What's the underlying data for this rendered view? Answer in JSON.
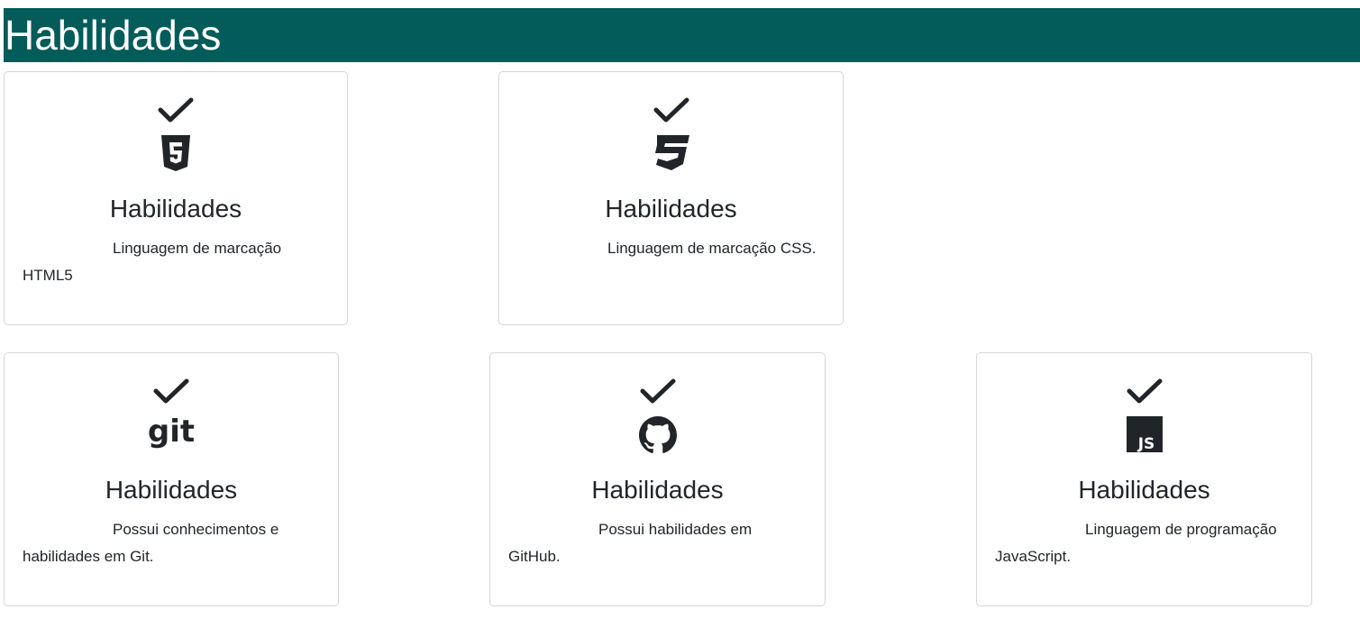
{
  "header": {
    "title": "Habilidades"
  },
  "cards": [
    {
      "icon": "html5-icon",
      "title": "Habilidades",
      "text": "Linguagem de marcação HTML5"
    },
    {
      "icon": "css3-icon",
      "title": "Habilidades",
      "text": "Linguagem de marcação CSS."
    },
    {
      "icon": "git-icon",
      "title": "Habilidades",
      "text": "Possui conhecimentos e habilidades em Git."
    },
    {
      "icon": "github-icon",
      "title": "Habilidades",
      "text": "Possui habilidades em GitHub."
    },
    {
      "icon": "javascript-icon",
      "title": "Habilidades",
      "text": "Linguagem de programação JavaScript."
    }
  ],
  "colors": {
    "header_bg": "#035b5a",
    "text": "#212529",
    "border": "#d6d6d6"
  }
}
